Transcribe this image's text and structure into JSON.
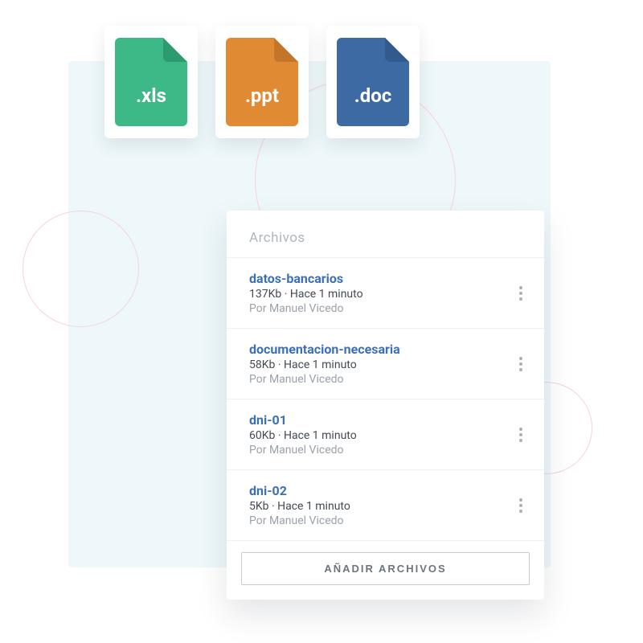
{
  "file_icons": [
    {
      "ext": ".xls",
      "fill": "#3db887",
      "fold": "#2c9b6e"
    },
    {
      "ext": ".ppt",
      "fill": "#e08a34",
      "fold": "#c3752a"
    },
    {
      "ext": ".doc",
      "fill": "#3d6aa3",
      "fold": "#335a8c"
    }
  ],
  "files_card": {
    "header": "Archivos",
    "add_button": "AÑADIR ARCHIVOS",
    "author_prefix": "Por ",
    "items": [
      {
        "title": "datos-bancarios",
        "meta": "137Kb · Hace 1 minuto",
        "author": "Manuel Vicedo"
      },
      {
        "title": "documentacion-necesaria",
        "meta": "58Kb · Hace 1 minuto",
        "author": "Manuel Vicedo"
      },
      {
        "title": "dni-01",
        "meta": "60Kb · Hace 1 minuto",
        "author": "Manuel Vicedo"
      },
      {
        "title": "dni-02",
        "meta": "5Kb · Hace 1 minuto",
        "author": "Manuel Vicedo"
      }
    ]
  }
}
